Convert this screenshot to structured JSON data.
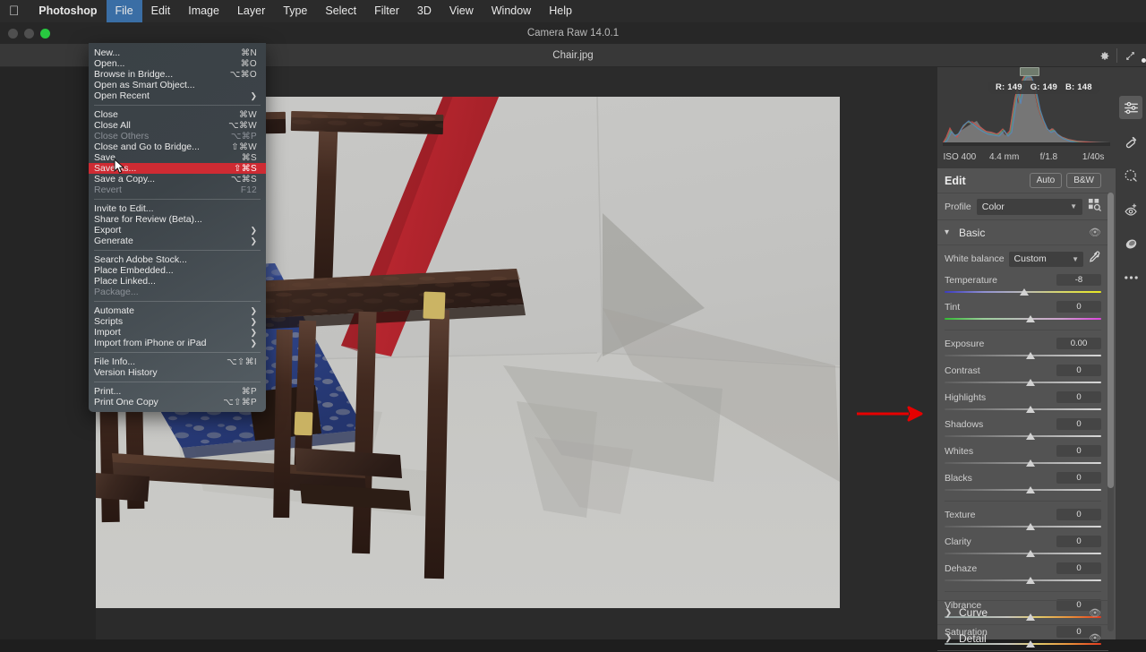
{
  "menubar": {
    "apple_icon": "apple-logo-icon",
    "items": [
      {
        "label": "Photoshop",
        "brand": true
      },
      {
        "label": "File",
        "active": true
      },
      {
        "label": "Edit"
      },
      {
        "label": "Image"
      },
      {
        "label": "Layer"
      },
      {
        "label": "Type"
      },
      {
        "label": "Select"
      },
      {
        "label": "Filter"
      },
      {
        "label": "3D"
      },
      {
        "label": "View"
      },
      {
        "label": "Window"
      },
      {
        "label": "Help"
      }
    ]
  },
  "window": {
    "title": "Camera Raw 14.0.1",
    "traffic_lights": [
      "#4f4f4f",
      "#4f4f4f",
      "#28c840"
    ]
  },
  "camera_raw_toolbar": {
    "filename": "Chair.jpg",
    "gear_icon": "gear-icon",
    "fullscreen_icon": "expand-arrows-icon"
  },
  "file_menu": {
    "groups": [
      [
        {
          "label": "New...",
          "shortcut": "⌘N"
        },
        {
          "label": "Open...",
          "shortcut": "⌘O"
        },
        {
          "label": "Browse in Bridge...",
          "shortcut": "⌥⌘O"
        },
        {
          "label": "Open as Smart Object...",
          "shortcut": ""
        },
        {
          "label": "Open Recent",
          "shortcut": "",
          "submenu": true
        }
      ],
      [
        {
          "label": "Close",
          "shortcut": "⌘W"
        },
        {
          "label": "Close All",
          "shortcut": "⌥⌘W"
        },
        {
          "label": "Close Others",
          "shortcut": "⌥⌘P",
          "disabled": true
        },
        {
          "label": "Close and Go to Bridge...",
          "shortcut": "⇧⌘W"
        },
        {
          "label": "Save",
          "shortcut": "⌘S"
        },
        {
          "label": "Save As...",
          "shortcut": "⇧⌘S",
          "highlighted": true
        },
        {
          "label": "Save a Copy...",
          "shortcut": "⌥⌘S"
        },
        {
          "label": "Revert",
          "shortcut": "F12",
          "disabled": true
        }
      ],
      [
        {
          "label": "Invite to Edit...",
          "shortcut": ""
        },
        {
          "label": "Share for Review (Beta)...",
          "shortcut": ""
        },
        {
          "label": "Export",
          "shortcut": "",
          "submenu": true
        },
        {
          "label": "Generate",
          "shortcut": "",
          "submenu": true
        }
      ],
      [
        {
          "label": "Search Adobe Stock...",
          "shortcut": ""
        },
        {
          "label": "Place Embedded...",
          "shortcut": ""
        },
        {
          "label": "Place Linked...",
          "shortcut": ""
        },
        {
          "label": "Package...",
          "shortcut": "",
          "disabled": true
        }
      ],
      [
        {
          "label": "Automate",
          "shortcut": "",
          "submenu": true
        },
        {
          "label": "Scripts",
          "shortcut": "",
          "submenu": true
        },
        {
          "label": "Import",
          "shortcut": "",
          "submenu": true
        },
        {
          "label": "Import from iPhone or iPad",
          "shortcut": "",
          "submenu": true
        }
      ],
      [
        {
          "label": "File Info...",
          "shortcut": "⌥⇧⌘I"
        },
        {
          "label": "Version History",
          "shortcut": ""
        }
      ],
      [
        {
          "label": "Print...",
          "shortcut": "⌘P"
        },
        {
          "label": "Print One Copy",
          "shortcut": "⌥⇧⌘P"
        }
      ]
    ]
  },
  "histogram": {
    "readout": {
      "r_label": "R: 149",
      "g_label": "G: 149",
      "b_label": "B: 148"
    },
    "exif": [
      "ISO 400",
      "4.4 mm",
      "f/1.8",
      "1/40s"
    ],
    "shadow_clip_icon": "shadow-clipping-icon",
    "highlight_clip_icon": "highlight-clipping-icon"
  },
  "edit_panel": {
    "title": "Edit",
    "auto_label": "Auto",
    "bw_label": "B&W",
    "profile_label": "Profile",
    "profile_value": "Color",
    "profile_browser_icon": "profile-browser-icon",
    "sections": [
      {
        "name": "Basic",
        "expanded": true,
        "eye_icon": "eye-toggle-icon"
      },
      {
        "name": "Curve",
        "expanded": false,
        "eye_icon": "eye-toggle-icon"
      },
      {
        "name": "Detail",
        "expanded": false,
        "eye_icon": "eye-toggle-icon"
      }
    ],
    "white_balance": {
      "label": "White balance",
      "value": "Custom",
      "eyedropper_icon": "eyedropper-icon"
    },
    "sliders": [
      {
        "name": "Temperature",
        "value": "-8",
        "pos": 51,
        "type": "temp"
      },
      {
        "name": "Tint",
        "value": "0",
        "pos": 55,
        "type": "tint"
      },
      {
        "name": "Exposure",
        "value": "0.00",
        "pos": 55,
        "type": "plain"
      },
      {
        "name": "Contrast",
        "value": "0",
        "pos": 55,
        "type": "plain"
      },
      {
        "name": "Highlights",
        "value": "0",
        "pos": 55,
        "type": "plain"
      },
      {
        "name": "Shadows",
        "value": "0",
        "pos": 55,
        "type": "plain"
      },
      {
        "name": "Whites",
        "value": "0",
        "pos": 55,
        "type": "plain"
      },
      {
        "name": "Blacks",
        "value": "0",
        "pos": 55,
        "type": "plain"
      },
      {
        "name": "Texture",
        "value": "0",
        "pos": 55,
        "type": "plain"
      },
      {
        "name": "Clarity",
        "value": "0",
        "pos": 55,
        "type": "plain"
      },
      {
        "name": "Dehaze",
        "value": "0",
        "pos": 55,
        "type": "plain"
      },
      {
        "name": "Vibrance",
        "value": "0",
        "pos": 55,
        "type": "sat"
      },
      {
        "name": "Saturation",
        "value": "0",
        "pos": 55,
        "type": "sat"
      }
    ]
  },
  "tool_rail": [
    {
      "icon": "edit-sliders-icon",
      "selected": true
    },
    {
      "icon": "healing-brush-icon",
      "selected": false
    },
    {
      "icon": "masking-icon",
      "selected": false
    },
    {
      "icon": "red-eye-icon",
      "selected": false
    },
    {
      "icon": "radial-gradient-icon",
      "selected": false
    },
    {
      "icon": "more-options-icon",
      "selected": false
    }
  ],
  "annotation": {
    "arrow_color": "#e60000",
    "shape": "right-arrow"
  },
  "cursor": {
    "shape": "arrow-pointer"
  },
  "photo": {
    "description": "Rietveld Red and Blue chair photograph"
  },
  "colors": {
    "menu_highlight": "#cf2b33",
    "panel_bg": "#535353",
    "canvas_bg": "#2b2b2b",
    "titlebar_bg": "#272727"
  }
}
